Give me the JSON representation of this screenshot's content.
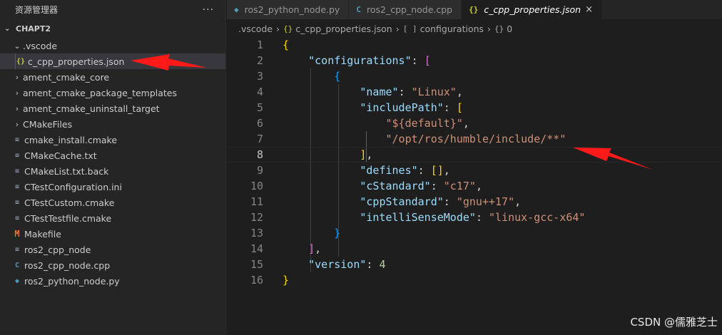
{
  "sidebar": {
    "title": "资源管理器",
    "more": "···",
    "section": "CHAPT2",
    "items": [
      {
        "label": ".vscode",
        "type": "folder-open",
        "icon": "chevron-down-icon"
      },
      {
        "label": "c_cpp_properties.json",
        "type": "json",
        "icon": "json-icon",
        "glyph": "{}"
      },
      {
        "label": "ament_cmake_core",
        "type": "folder",
        "icon": "chevron-right-icon"
      },
      {
        "label": "ament_cmake_package_templates",
        "type": "folder",
        "icon": "chevron-right-icon"
      },
      {
        "label": "ament_cmake_uninstall_target",
        "type": "folder",
        "icon": "chevron-right-icon"
      },
      {
        "label": "CMakeFiles",
        "type": "folder",
        "icon": "chevron-right-icon"
      },
      {
        "label": "cmake_install.cmake",
        "type": "text",
        "icon": "text-file-icon"
      },
      {
        "label": "CMakeCache.txt",
        "type": "text",
        "icon": "text-file-icon"
      },
      {
        "label": "CMakeList.txt.back",
        "type": "text",
        "icon": "text-file-icon"
      },
      {
        "label": "CTestConfiguration.ini",
        "type": "text",
        "icon": "text-file-icon"
      },
      {
        "label": "CTestCustom.cmake",
        "type": "text",
        "icon": "text-file-icon"
      },
      {
        "label": "CTestTestfile.cmake",
        "type": "text",
        "icon": "text-file-icon"
      },
      {
        "label": "Makefile",
        "type": "make",
        "icon": "makefile-icon",
        "glyph": "M"
      },
      {
        "label": "ros2_cpp_node",
        "type": "text",
        "icon": "text-file-icon"
      },
      {
        "label": "ros2_cpp_node.cpp",
        "type": "cpp",
        "icon": "cpp-file-icon",
        "glyph": "C"
      },
      {
        "label": "ros2_python_node.py",
        "type": "py",
        "icon": "python-file-icon",
        "glyph": "◆"
      }
    ]
  },
  "tabs": [
    {
      "label": "ros2_python_node.py",
      "icon": "python-file-icon",
      "glyph": "◆",
      "active": false
    },
    {
      "label": "ros2_cpp_node.cpp",
      "icon": "cpp-file-icon",
      "glyph": "C",
      "active": false
    },
    {
      "label": "c_cpp_properties.json",
      "icon": "json-icon",
      "glyph": "{}",
      "active": true,
      "close": "×"
    }
  ],
  "breadcrumb": {
    "folder": ".vscode",
    "file": "c_cpp_properties.json",
    "file_glyph": "{}",
    "node1": "configurations",
    "node1_glyph": "[ ]",
    "node2": "0",
    "node2_glyph": "{}"
  },
  "code_lines": [
    {
      "n": "1"
    },
    {
      "n": "2"
    },
    {
      "n": "3"
    },
    {
      "n": "4"
    },
    {
      "n": "5"
    },
    {
      "n": "6"
    },
    {
      "n": "7"
    },
    {
      "n": "8"
    },
    {
      "n": "9"
    },
    {
      "n": "10"
    },
    {
      "n": "11"
    },
    {
      "n": "12"
    },
    {
      "n": "13"
    },
    {
      "n": "14"
    },
    {
      "n": "15"
    },
    {
      "n": "16"
    }
  ],
  "code": {
    "l2_key": "\"configurations\"",
    "l4_key": "\"name\"",
    "l4_val": "\"Linux\"",
    "l5_key": "\"includePath\"",
    "l6_val": "\"${default}\"",
    "l7_val": "\"/opt/ros/humble/include/**\"",
    "l9_key": "\"defines\"",
    "l10_key": "\"cStandard\"",
    "l10_val": "\"c17\"",
    "l11_key": "\"cppStandard\"",
    "l11_val": "\"gnu++17\"",
    "l12_key": "\"intelliSenseMode\"",
    "l12_val": "\"linux-gcc-x64\"",
    "l15_key": "\"version\"",
    "l15_val": "4"
  },
  "watermark": "CSDN @儒雅芝士",
  "colors": {
    "annotation_arrow": "#ff1a1a",
    "key": "#9cdcfe",
    "string": "#ce9178",
    "number": "#b5cea8"
  }
}
